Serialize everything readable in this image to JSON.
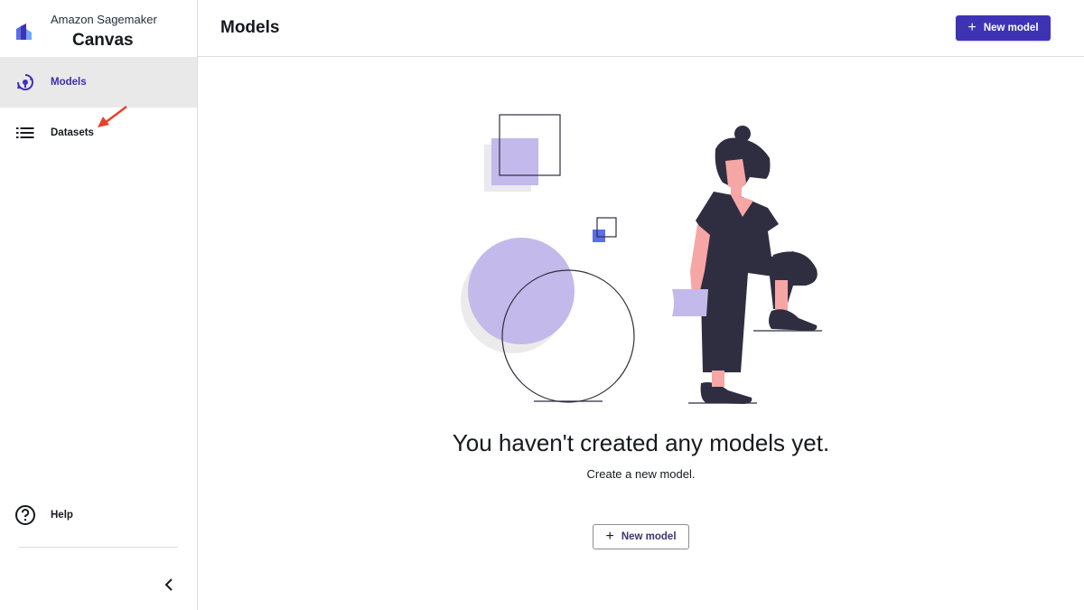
{
  "app": {
    "subtitle": "Amazon Sagemaker",
    "title": "Canvas"
  },
  "sidebar": {
    "items": [
      {
        "label": "Models",
        "icon": "models-icon",
        "active": true
      },
      {
        "label": "Datasets",
        "icon": "list-icon",
        "active": false
      }
    ],
    "help_label": "Help",
    "collapse_icon": "chevron-left-icon"
  },
  "header": {
    "title": "Models",
    "new_model_label": "New model"
  },
  "empty_state": {
    "title": "You haven't created any models yet.",
    "subtitle": "Create a new model.",
    "button_label": "New model"
  },
  "colors": {
    "accent": "#3f33b5",
    "illustration_purple": "#c3b9ea",
    "illustration_dark": "#2f2e41",
    "skin": "#f7a6a6",
    "annotation_arrow": "#e8402a"
  }
}
